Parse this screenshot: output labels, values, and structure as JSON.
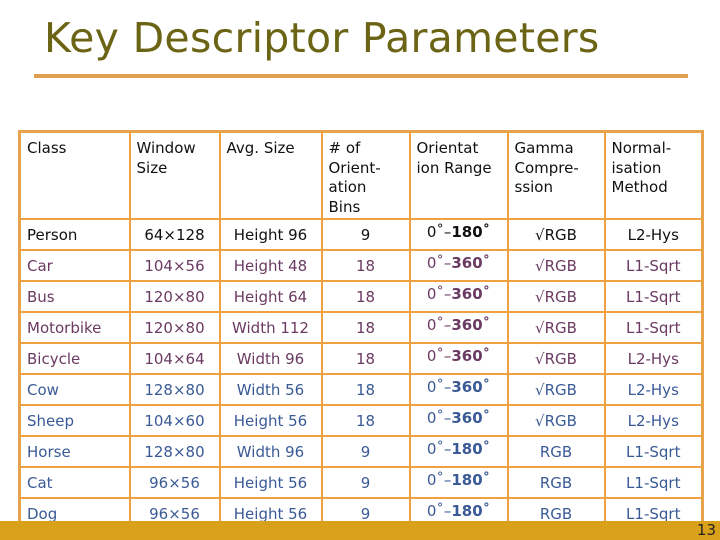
{
  "title": "Key Descriptor Parameters",
  "colors": {
    "title": "#6b6414",
    "rule": "#e0a050",
    "table_border": "#f0a040",
    "row_black": "#111111",
    "row_purple": "#6b3a62",
    "row_blue": "#3a5a96",
    "footer_bar": "#d9a01a"
  },
  "table": {
    "headers": [
      "Class",
      "Window Size",
      "Avg. Size",
      "# of Orient- ation Bins",
      "Orientat ion Range",
      "Gamma Compre- ssion",
      "Normal- isation Method"
    ],
    "rows": [
      {
        "class": "Person",
        "window": "64×128",
        "avg": "Height 96",
        "bins": "9",
        "range_start": "0˚–",
        "range_end": "180˚",
        "gamma": "√RGB",
        "norm": "L2-Hys",
        "color": "black"
      },
      {
        "class": "Car",
        "window": "104×56",
        "avg": "Height 48",
        "bins": "18",
        "range_start": "0˚–",
        "range_end": "360˚",
        "gamma": "√RGB",
        "norm": "L1-Sqrt",
        "color": "purple"
      },
      {
        "class": "Bus",
        "window": "120×80",
        "avg": "Height 64",
        "bins": "18",
        "range_start": "0˚–",
        "range_end": "360˚",
        "gamma": "√RGB",
        "norm": "L1-Sqrt",
        "color": "purple"
      },
      {
        "class": "Motorbike",
        "window": "120×80",
        "avg": "Width 112",
        "bins": "18",
        "range_start": "0˚–",
        "range_end": "360˚",
        "gamma": "√RGB",
        "norm": "L1-Sqrt",
        "color": "purple"
      },
      {
        "class": "Bicycle",
        "window": "104×64",
        "avg": "Width 96",
        "bins": "18",
        "range_start": "0˚–",
        "range_end": "360˚",
        "gamma": "√RGB",
        "norm": "L2-Hys",
        "color": "purple"
      },
      {
        "class": "Cow",
        "window": "128×80",
        "avg": "Width 56",
        "bins": "18",
        "range_start": "0˚–",
        "range_end": "360˚",
        "gamma": "√RGB",
        "norm": "L2-Hys",
        "color": "blue"
      },
      {
        "class": "Sheep",
        "window": "104×60",
        "avg": "Height 56",
        "bins": "18",
        "range_start": "0˚–",
        "range_end": "360˚",
        "gamma": "√RGB",
        "norm": "L2-Hys",
        "color": "blue"
      },
      {
        "class": "Horse",
        "window": "128×80",
        "avg": "Width 96",
        "bins": "9",
        "range_start": "0˚–",
        "range_end": "180˚",
        "gamma": "RGB",
        "norm": "L1-Sqrt",
        "color": "blue"
      },
      {
        "class": "Cat",
        "window": "96×56",
        "avg": "Height 56",
        "bins": "9",
        "range_start": "0˚–",
        "range_end": "180˚",
        "gamma": "RGB",
        "norm": "L1-Sqrt",
        "color": "blue"
      },
      {
        "class": "Dog",
        "window": "96×56",
        "avg": "Height 56",
        "bins": "9",
        "range_start": "0˚–",
        "range_end": "180˚",
        "gamma": "RGB",
        "norm": "L1-Sqrt",
        "color": "blue"
      }
    ]
  },
  "footer": {
    "page_number": "13"
  }
}
